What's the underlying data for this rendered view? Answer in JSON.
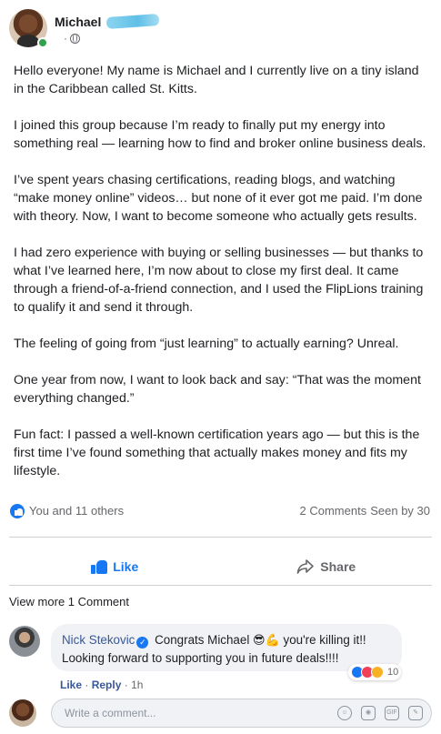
{
  "post": {
    "author_name": "Michael",
    "meta_dot": "·",
    "paragraphs": [
      "Hello everyone! My name is Michael and I currently live on a tiny island in the Caribbean called St. Kitts.",
      "I joined this group because I’m ready to finally put my energy into something real — learning how to find and broker online business deals.",
      "I’ve spent years chasing certifications, reading blogs, and watching “make money online” videos… but none of it ever got me paid. I’m done with theory. Now, I want to become someone who actually gets results.",
      "I had zero experience with buying or selling businesses — but thanks to what I’ve learned here, I’m now about to close my first deal. It came through a friend-of-a-friend connection, and I used the FlipLions training to qualify it and send it through.",
      "The feeling of going from “just learning” to actually earning? Unreal.",
      "One year from now, I want to look back and say: “That was the moment everything changed.”",
      "Fun fact: I passed a well-known certification years ago — but this is the first time I’ve found something that actually makes money and fits my lifestyle."
    ]
  },
  "reactions": {
    "reactors": "You and 11 others",
    "comments": "2 Comments",
    "seen": "Seen by 30"
  },
  "actions": {
    "like_label": "Like",
    "share_label": "Share"
  },
  "comments_section": {
    "view_more": "View more 1 Comment"
  },
  "comment": {
    "name": "Nick Stekovic",
    "text_before": "Congrats Michael",
    "emoji_1": "😎💪",
    "text_after": "you're killing it!!",
    "line2": "Looking forward to supporting you in future deals!!!!",
    "react_count": "10",
    "like_link": "Like",
    "sep": "·",
    "reply_link": "Reply",
    "time": "1h"
  },
  "composer": {
    "placeholder": "Write a comment..."
  },
  "colors": {
    "brand_blue": "#1877f2",
    "link_blue": "#385898",
    "online_green": "#31a24c",
    "love_red": "#f33e58",
    "haha_yellow": "#f7b125"
  },
  "icons": [
    "globe-icon",
    "like-thumb-icon",
    "share-arrow-icon",
    "verified-badge-icon",
    "emoji-icon",
    "camera-icon",
    "gif-icon",
    "sticker-icon"
  ]
}
